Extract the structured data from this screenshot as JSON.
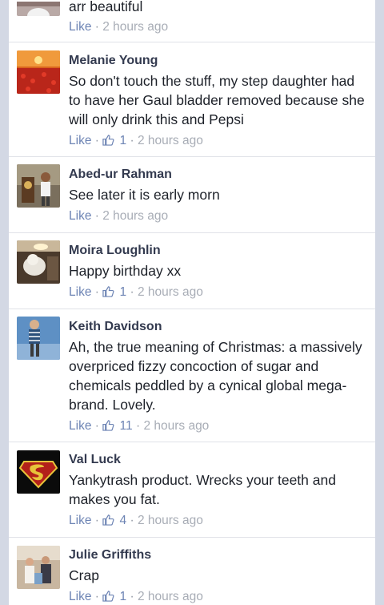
{
  "comments": [
    {
      "name": "",
      "text": "arr beautiful",
      "like_label": "Like",
      "like_count": "",
      "time": "2 hours ago"
    },
    {
      "name": "Melanie Young",
      "text": "So don't touch the stuff, my step daughter had to have her Gaul bladder removed because she will only drink this and Pepsi",
      "like_label": "Like",
      "like_count": "1",
      "time": "2 hours ago"
    },
    {
      "name": "Abed-ur Rahman",
      "text": "See later it is early morn",
      "like_label": "Like",
      "like_count": "",
      "time": "2 hours ago"
    },
    {
      "name": "Moira Loughlin",
      "text": "Happy birthday xx",
      "like_label": "Like",
      "like_count": "1",
      "time": "2 hours ago"
    },
    {
      "name": "Keith Davidson",
      "text": "Ah, the true meaning of Christmas: a massively overpriced fizzy concoction of sugar and chemicals peddled by a cynical global mega-brand. Lovely.",
      "like_label": "Like",
      "like_count": "11",
      "time": "2 hours ago"
    },
    {
      "name": "Val Luck",
      "text": "Yankytrash product. Wrecks your teeth and makes you fat.",
      "like_label": "Like",
      "like_count": "4",
      "time": "2 hours ago"
    },
    {
      "name": "Julie Griffiths",
      "text": "Crap",
      "like_label": "Like",
      "like_count": "1",
      "time": "2 hours ago"
    }
  ],
  "icons": {
    "like_count_icon": "thumbs-up-icon",
    "separator": "·"
  }
}
